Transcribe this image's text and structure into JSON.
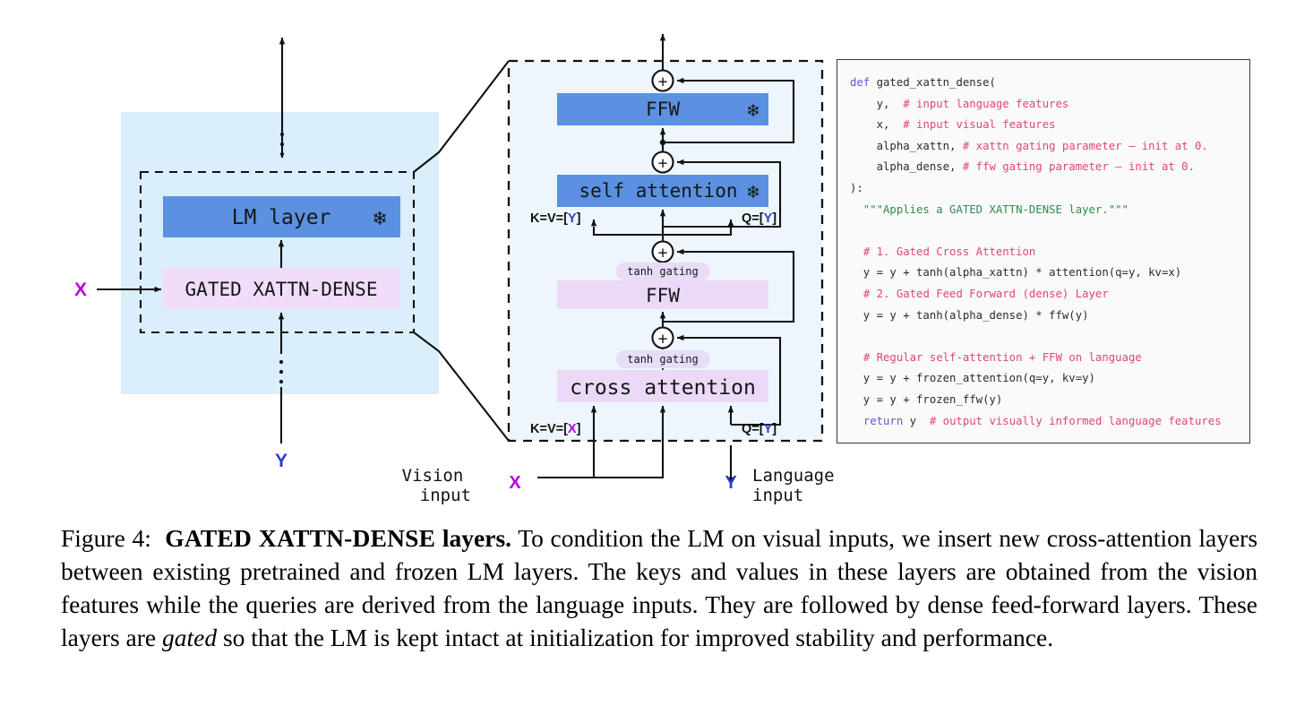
{
  "figure": {
    "label": "Figure 4:",
    "title_smallcaps": "GATED XATTN-DENSE",
    "title_bold_tail": "layers.",
    "caption_body_1": " To condition the LM on visual inputs, we insert new cross-attention layers between existing pretrained and frozen LM layers. The keys and values in these layers are obtained from the vision features while the queries are derived from the language inputs. They are followed by dense feed-forward layers. These layers are ",
    "caption_italic": "gated",
    "caption_body_2": " so that the LM is kept intact at initialization for improved stability and performance."
  },
  "colors": {
    "frozen_blue": "#5b91e0",
    "trainable_lavender": "#ecd9f7",
    "panel_light_blue": "#daeefb",
    "zoom_panel_bg": "#eef6fd",
    "gating_pill": "#e8dcf7",
    "x_magenta": "#b800e0",
    "y_blue": "#2b3fc4",
    "stroke": "#111111",
    "code_keyword": "#5b5bd6",
    "code_comment": "#e0457b",
    "code_string": "#2f8a4f",
    "code_bg": "#fafafa"
  },
  "left_panel": {
    "lm_layer_label": "LM layer",
    "gated_xattn_label": "GATED XATTN-DENSE",
    "frozen_icon": "❄",
    "vision_symbol": "X",
    "language_symbol": "Y",
    "vertical_dots": "⋮"
  },
  "zoom_panel": {
    "blocks": [
      {
        "name": "ffw-frozen",
        "label": "FFW",
        "frozen": true
      },
      {
        "name": "self-attention-frozen",
        "label": "self attention",
        "frozen": true
      },
      {
        "name": "ffw-trainable",
        "label": "FFW",
        "frozen": false
      },
      {
        "name": "cross-attention-trainable",
        "label": "cross attention",
        "frozen": false
      }
    ],
    "gating_label": "tanh gating",
    "frozen_icon": "❄",
    "plus_symbol": "+",
    "kv_self_label_prefix": "K=V=[",
    "kv_self_label_sym": "Y",
    "kv_self_label_suffix": "]",
    "q_self_label_prefix": "Q=[",
    "q_self_label_sym": "Y",
    "q_self_label_suffix": "]",
    "kv_cross_label_prefix": "K=V=[",
    "kv_cross_label_sym": "X",
    "kv_cross_label_suffix": "]",
    "q_cross_label_prefix": "Q=[",
    "q_cross_label_sym": "Y",
    "q_cross_label_suffix": "]"
  },
  "inputs": {
    "vision_line1": "Vision",
    "vision_line2": "input",
    "vision_symbol": "X",
    "language_line1": "Language",
    "language_line2": "input",
    "language_symbol": "Y"
  },
  "code": {
    "lines": [
      [
        {
          "t": "def",
          "c": "kw"
        },
        {
          "t": " gated_xattn_dense(",
          "c": "pln"
        }
      ],
      [
        {
          "t": "    y,  ",
          "c": "pln"
        },
        {
          "t": "# input language features",
          "c": "com"
        }
      ],
      [
        {
          "t": "    x,  ",
          "c": "pln"
        },
        {
          "t": "# input visual features",
          "c": "com"
        }
      ],
      [
        {
          "t": "    alpha_xattn, ",
          "c": "pln"
        },
        {
          "t": "# xattn gating parameter – init at 0.",
          "c": "com"
        }
      ],
      [
        {
          "t": "    alpha_dense, ",
          "c": "pln"
        },
        {
          "t": "# ffw gating parameter – init at 0.",
          "c": "com"
        }
      ],
      [
        {
          "t": "):",
          "c": "pln"
        }
      ],
      [
        {
          "t": "  \"\"\"Applies a GATED XATTN-DENSE layer.\"\"\"",
          "c": "str"
        }
      ],
      [
        {
          "t": "",
          "c": "pln"
        }
      ],
      [
        {
          "t": "  ",
          "c": "pln"
        },
        {
          "t": "# 1. Gated Cross Attention",
          "c": "com"
        }
      ],
      [
        {
          "t": "  y = y + tanh(alpha_xattn) * attention(q=y, kv=x)",
          "c": "pln"
        }
      ],
      [
        {
          "t": "  ",
          "c": "pln"
        },
        {
          "t": "# 2. Gated Feed Forward (dense) Layer",
          "c": "com"
        }
      ],
      [
        {
          "t": "  y = y + tanh(alpha_dense) * ffw(y)",
          "c": "pln"
        }
      ],
      [
        {
          "t": "",
          "c": "pln"
        }
      ],
      [
        {
          "t": "  ",
          "c": "pln"
        },
        {
          "t": "# Regular self-attention + FFW on language",
          "c": "com"
        }
      ],
      [
        {
          "t": "  y = y + frozen_attention(q=y, kv=y)",
          "c": "pln"
        }
      ],
      [
        {
          "t": "  y = y + frozen_ffw(y)",
          "c": "pln"
        }
      ],
      [
        {
          "t": "  ",
          "c": "pln"
        },
        {
          "t": "return",
          "c": "kw"
        },
        {
          "t": " y  ",
          "c": "pln"
        },
        {
          "t": "# output visually informed language features",
          "c": "com"
        }
      ]
    ]
  }
}
